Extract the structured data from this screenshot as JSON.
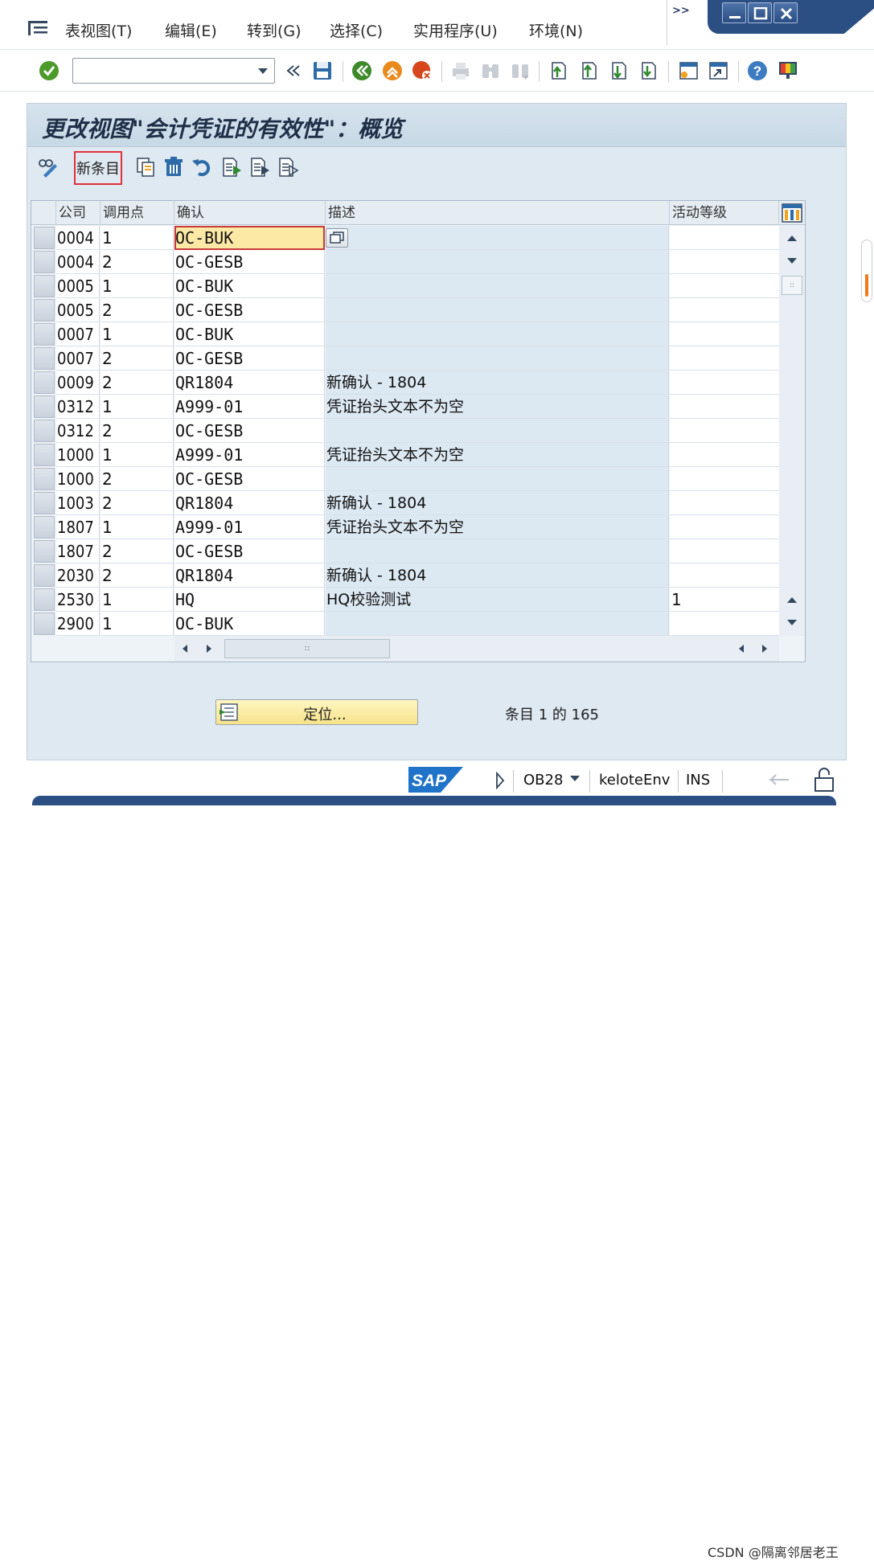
{
  "menubar": {
    "items": [
      "表视图(T)",
      "编辑(E)",
      "转到(G)",
      "选择(C)",
      "实用程序(U)",
      "环境(N)"
    ],
    "more": ">>"
  },
  "toolbar": {
    "command_field": "",
    "icons": [
      "enter-icon",
      "back-icon",
      "save-icon",
      "back-green-icon",
      "exit-icon",
      "cancel-icon",
      "print-icon",
      "find-icon",
      "find-next-icon",
      "first-page-icon",
      "prev-page-icon",
      "next-page-icon",
      "last-page-icon",
      "new-session-icon",
      "shortcut-icon",
      "help-icon",
      "customize-icon"
    ]
  },
  "screen": {
    "title": "更改视图\"会计凭证的有效性\"：概览",
    "new_entry_label": "新条目"
  },
  "table": {
    "headers": [
      "公司",
      "调用点",
      "确认",
      "描述",
      "活动等级"
    ],
    "rows": [
      {
        "company": "0004",
        "point": "1",
        "validation": "OC-BUK",
        "description": "",
        "level": ""
      },
      {
        "company": "0004",
        "point": "2",
        "validation": "OC-GESB",
        "description": "",
        "level": ""
      },
      {
        "company": "0005",
        "point": "1",
        "validation": "OC-BUK",
        "description": "",
        "level": ""
      },
      {
        "company": "0005",
        "point": "2",
        "validation": "OC-GESB",
        "description": "",
        "level": ""
      },
      {
        "company": "0007",
        "point": "1",
        "validation": "OC-BUK",
        "description": "",
        "level": ""
      },
      {
        "company": "0007",
        "point": "2",
        "validation": "OC-GESB",
        "description": "",
        "level": ""
      },
      {
        "company": "0009",
        "point": "2",
        "validation": "QR1804",
        "description": "新确认 - 1804",
        "level": ""
      },
      {
        "company": "0312",
        "point": "1",
        "validation": "A999-01",
        "description": "凭证抬头文本不为空",
        "level": ""
      },
      {
        "company": "0312",
        "point": "2",
        "validation": "OC-GESB",
        "description": "",
        "level": ""
      },
      {
        "company": "1000",
        "point": "1",
        "validation": "A999-01",
        "description": "凭证抬头文本不为空",
        "level": ""
      },
      {
        "company": "1000",
        "point": "2",
        "validation": "OC-GESB",
        "description": "",
        "level": ""
      },
      {
        "company": "1003",
        "point": "2",
        "validation": "QR1804",
        "description": "新确认 - 1804",
        "level": ""
      },
      {
        "company": "1807",
        "point": "1",
        "validation": "A999-01",
        "description": "凭证抬头文本不为空",
        "level": ""
      },
      {
        "company": "1807",
        "point": "2",
        "validation": "OC-GESB",
        "description": "",
        "level": ""
      },
      {
        "company": "2030",
        "point": "2",
        "validation": "QR1804",
        "description": "新确认 - 1804",
        "level": ""
      },
      {
        "company": "2530",
        "point": "1",
        "validation": "HQ",
        "description": "HQ校验测试",
        "level": "1"
      },
      {
        "company": "2900",
        "point": "1",
        "validation": "OC-BUK",
        "description": "",
        "level": ""
      }
    ],
    "scroll_thumb": "::"
  },
  "position_button": "定位...",
  "entry_info": "条目 1 的 165",
  "statusbar": {
    "tcode": "OB28",
    "system": "keloteEnv",
    "mode": "INS",
    "sap_logo": "SAP"
  },
  "watermark": "CSDN @隔离邻居老王",
  "colors": {
    "frame": "#2b4e83",
    "panel": "#dfe9f1",
    "highlight": "#e0303a",
    "focus_cell": "#fde9a6",
    "button_yellow": "#f6e38a"
  }
}
